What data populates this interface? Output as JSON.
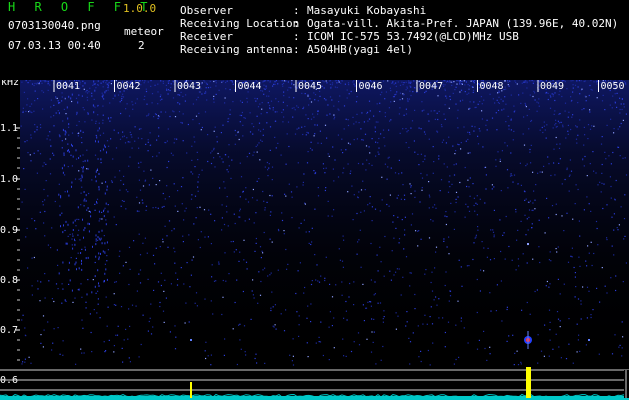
{
  "app": {
    "title": "H R O F F T",
    "version": "1.0.0"
  },
  "file": {
    "name": "0703130040.png",
    "datetime": "07.03.13 00:40"
  },
  "meteor": {
    "label": "meteor",
    "count": "2"
  },
  "info": [
    {
      "label": "Observer",
      "value": "Masayuki Kobayashi"
    },
    {
      "label": "Receiving Location",
      "value": "Ogata-vill. Akita-Pref. JAPAN (139.96E, 40.02N)"
    },
    {
      "label": "Receiver",
      "value": "ICOM IC-575 53.7492(@LCD)MHz USB"
    },
    {
      "label": "Receiving antenna",
      "value": "A504HB(yagi 4el)"
    }
  ],
  "spectrogram": {
    "unit": "kHz",
    "columns": [
      "0041",
      "0042",
      "0043",
      "0044",
      "0045",
      "0046",
      "0047",
      "0048",
      "0049",
      "0050"
    ],
    "y_ticks": [
      "1.1",
      "1.0",
      "0.9",
      "0.8",
      "0.7",
      "0.6"
    ],
    "colors": {
      "background": "#000000",
      "noise": "#2a3cd8",
      "signal": "#ffff00",
      "trace": "#00c8c8"
    },
    "meteor_events": [
      {
        "column": "0048",
        "kind": "head echo + strong echo"
      },
      {
        "column": "0043",
        "kind": "weak echo"
      }
    ]
  }
}
